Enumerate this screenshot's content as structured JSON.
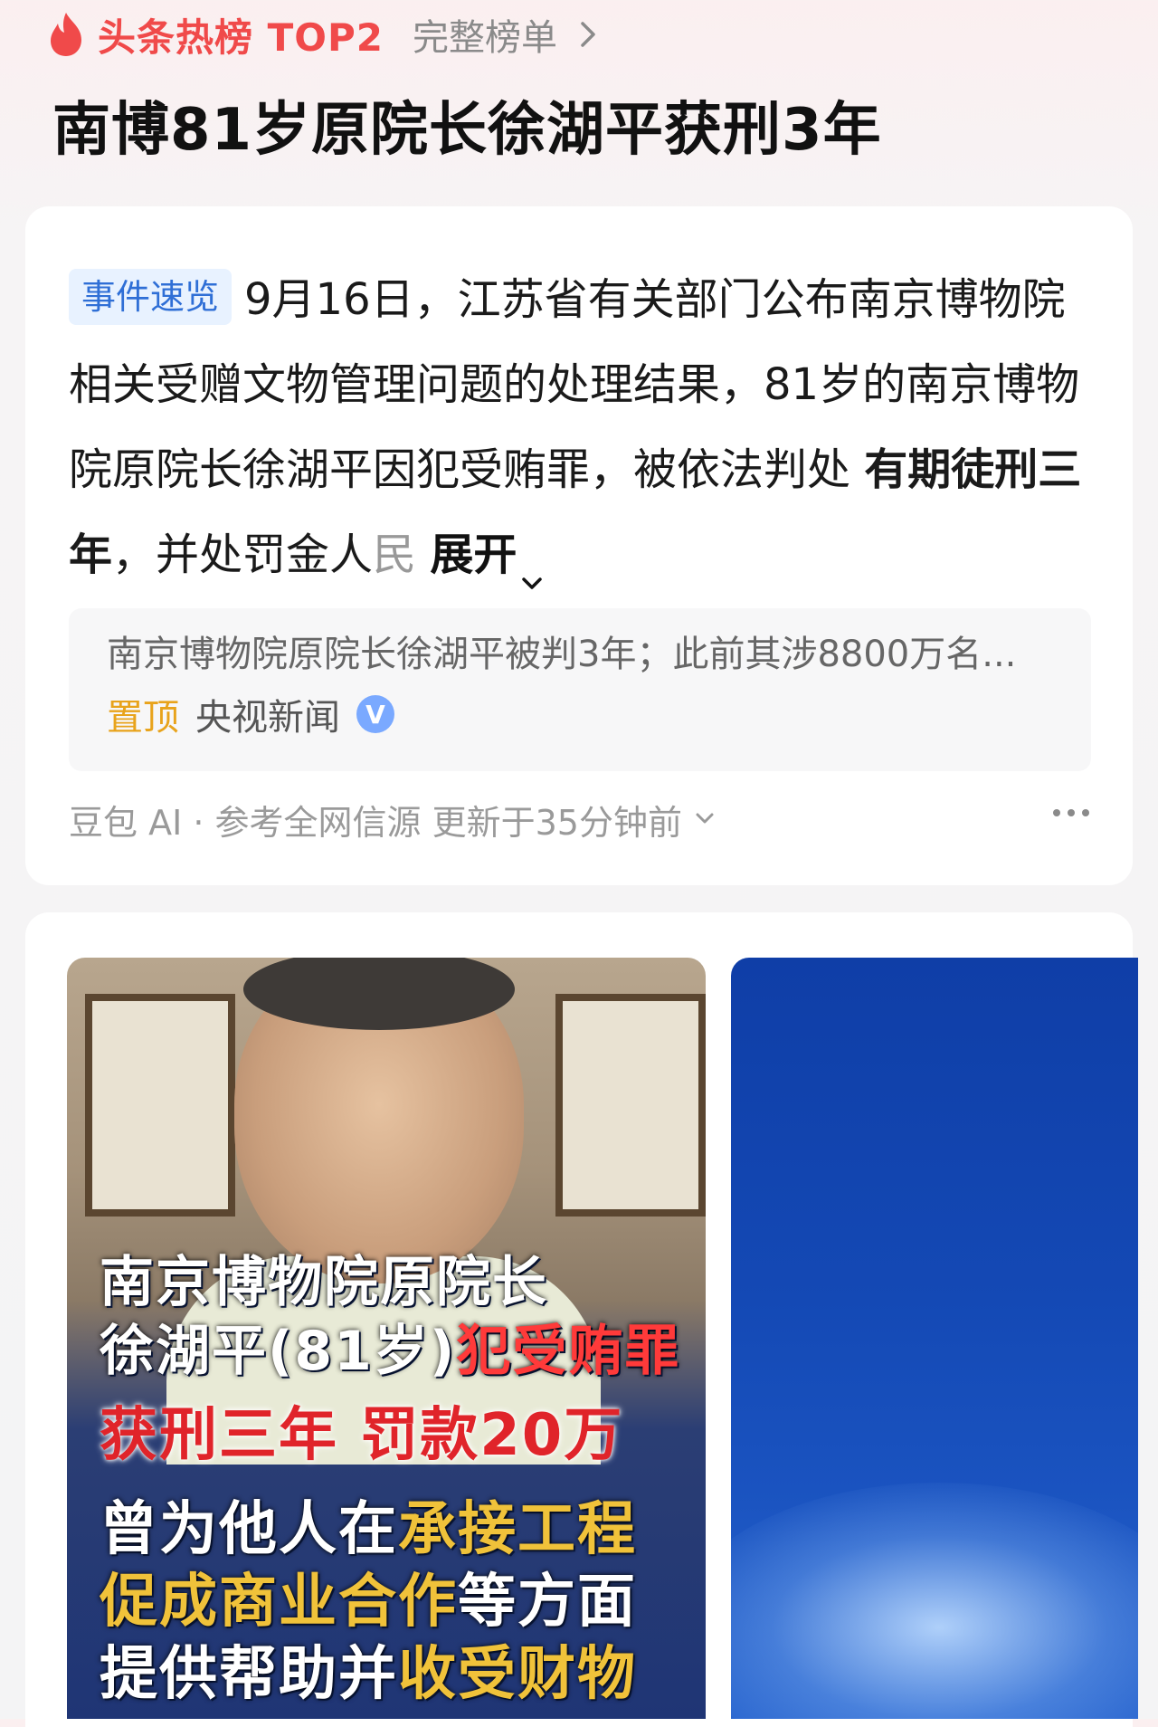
{
  "top_bar": {
    "hot_label": "头条热榜 TOP2",
    "full_list_label": "完整榜单",
    "icons": {
      "flame": "flame-icon",
      "chevron": "chevron-right-icon"
    }
  },
  "headline": "南博81岁原院长徐湖平获刑3年",
  "summary": {
    "tag": "事件速览",
    "text_1": "9月16日，江苏省有关部门公布南京博物院相关受赠文物管理问题的处理结果，81岁的南京博物院原院长徐湖平因犯受贿罪，被依法判处",
    "text_bold": "有期徒刑三年",
    "text_2": "，并处罚金人",
    "text_fade": "民",
    "expand_label": "展开"
  },
  "source": {
    "title": "南京博物院原院长徐湖平被判3年；此前其涉8800万名...",
    "pin_label": "置顶",
    "publisher": "央视新闻",
    "verified_glyph": "V"
  },
  "footer": {
    "text": "豆包 AI · 参考全网信源 更新于35分钟前"
  },
  "image_card": {
    "line1": "南京博物院原院长",
    "line2_a": "徐湖平(81岁)",
    "line2_b": "犯受贿罪",
    "line3": "获刑三年 罚款20万",
    "line4_a": "曾为他人在",
    "line4_b": "承接工程",
    "line5_a": "促成商业合作",
    "line5_b": "等方面",
    "line6_a": "提供帮助并",
    "line6_b": "收受财物"
  },
  "colors": {
    "accent_red": "#f04a4a",
    "tag_blue": "#2f6fd6",
    "pin_orange": "#e8a31b",
    "panel_blue": "#1449b5"
  }
}
